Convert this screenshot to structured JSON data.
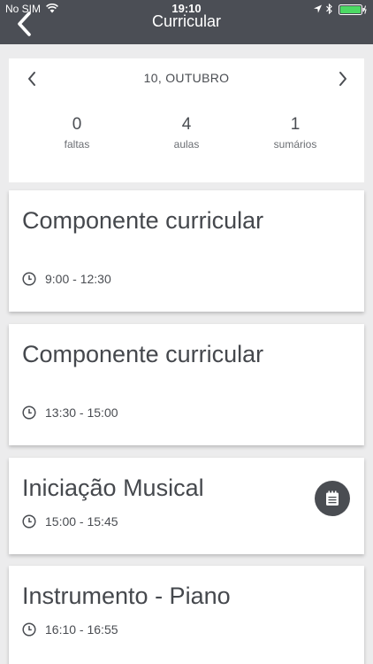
{
  "status_bar": {
    "carrier": "No SIM",
    "time": "19:10"
  },
  "header": {
    "title": "Curricular"
  },
  "date_nav": {
    "date": "10, OUTUBRO",
    "stats": [
      {
        "value": "0",
        "label": "faltas"
      },
      {
        "value": "4",
        "label": "aulas"
      },
      {
        "value": "1",
        "label": "sumários"
      }
    ]
  },
  "lessons": [
    {
      "title": "Componente curricular",
      "time": "9:00 - 12:30"
    },
    {
      "title": "Componente curricular",
      "time": "13:30 - 15:00"
    },
    {
      "title": "Iniciação Musical",
      "time": "15:00 - 15:45",
      "has_summary": true
    },
    {
      "title": "Instrumento - Piano",
      "time": "16:10 - 16:55"
    }
  ],
  "colors": {
    "header_bg": "#4b4e55",
    "background": "#ececed",
    "text": "#4a4d52",
    "battery": "#4cd964"
  }
}
